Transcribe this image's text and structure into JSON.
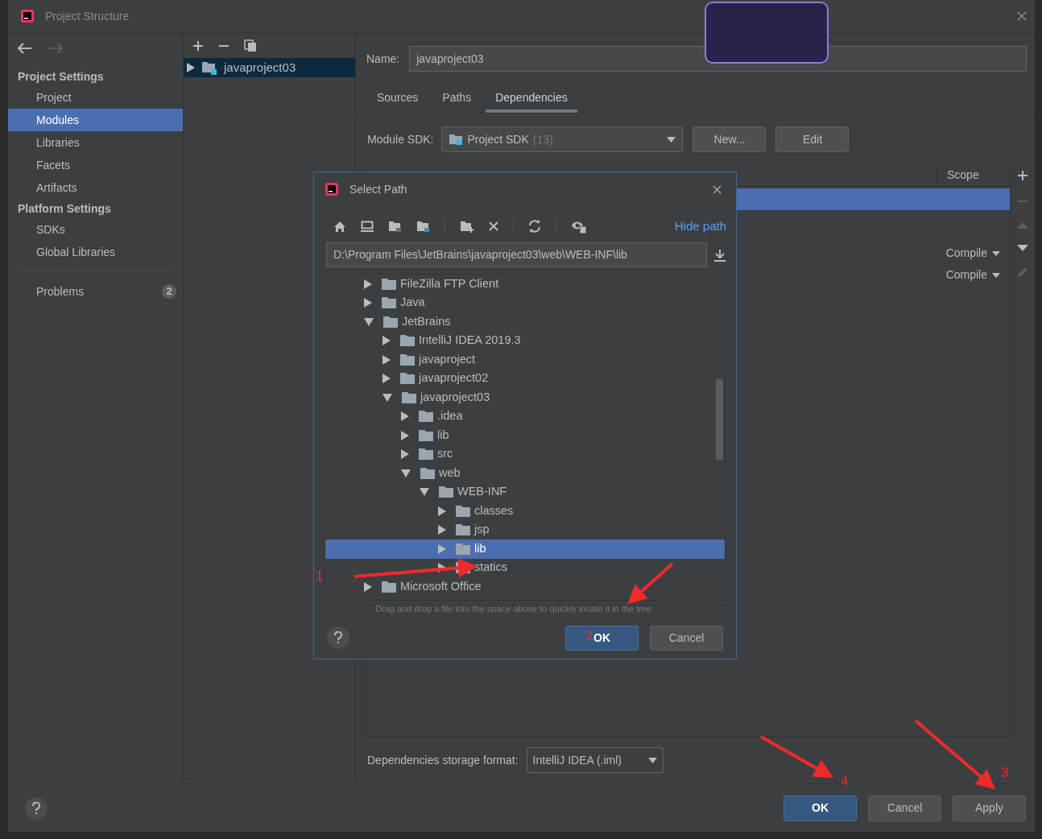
{
  "window": {
    "title": "Project Structure"
  },
  "sidebar": {
    "sections": [
      {
        "heading": "Project Settings",
        "items": [
          {
            "label": "Project",
            "selected": false
          },
          {
            "label": "Modules",
            "selected": true
          },
          {
            "label": "Libraries",
            "selected": false
          },
          {
            "label": "Facets",
            "selected": false
          },
          {
            "label": "Artifacts",
            "selected": false
          }
        ]
      },
      {
        "heading": "Platform Settings",
        "items": [
          {
            "label": "SDKs",
            "selected": false
          },
          {
            "label": "Global Libraries",
            "selected": false
          }
        ]
      }
    ],
    "problems": {
      "label": "Problems",
      "count": "2"
    }
  },
  "modules": [
    {
      "label": "javaproject03",
      "selected": true,
      "expanded": false
    }
  ],
  "module": {
    "name_label": "Name:",
    "name": "javaproject03",
    "tabs": [
      {
        "label": "Sources",
        "selected": false
      },
      {
        "label": "Paths",
        "selected": false
      },
      {
        "label": "Dependencies",
        "selected": true
      }
    ],
    "sdk_label": "Module SDK:",
    "sdk": "Project SDK",
    "sdk_version": "(13)",
    "buttons": [
      "New...",
      "Edit"
    ],
    "table": {
      "columns": [
        "Scope"
      ],
      "rows": [
        {
          "selected": true
        },
        {
          "selected": false,
          "scope": "Compile"
        },
        {
          "selected": false,
          "scope": "Compile"
        }
      ]
    },
    "storage_label": "Dependencies storage format:",
    "storage": "IntelliJ IDEA (.iml)"
  },
  "dialog": {
    "title": "Select Path",
    "hide_path": "Hide path",
    "path": "D:\\Program Files\\JetBrains\\javaproject03\\web\\WEB-INF\\lib",
    "tree": [
      {
        "label": "FileZilla FTP Client",
        "expanded": false,
        "selected": false
      },
      {
        "label": "Java",
        "expanded": false,
        "selected": false
      },
      {
        "label": "JetBrains",
        "expanded": true,
        "selected": false,
        "children": [
          {
            "label": "IntelliJ IDEA 2019.3",
            "expanded": false,
            "selected": false
          },
          {
            "label": "javaproject",
            "expanded": false,
            "selected": false
          },
          {
            "label": "javaproject02",
            "expanded": false,
            "selected": false
          },
          {
            "label": "javaproject03",
            "expanded": true,
            "selected": false,
            "children": [
              {
                "label": ".idea",
                "expanded": false,
                "selected": false
              },
              {
                "label": "lib",
                "expanded": false,
                "selected": false
              },
              {
                "label": "src",
                "expanded": false,
                "selected": false
              },
              {
                "label": "web",
                "expanded": true,
                "selected": false,
                "children": [
                  {
                    "label": "WEB-INF",
                    "expanded": true,
                    "selected": false,
                    "children": [
                      {
                        "label": "classes",
                        "expanded": false,
                        "selected": false
                      },
                      {
                        "label": "jsp",
                        "expanded": false,
                        "selected": false
                      },
                      {
                        "label": "lib",
                        "expanded": false,
                        "selected": true
                      },
                      {
                        "label": "statics",
                        "expanded": false,
                        "selected": false
                      }
                    ]
                  }
                ]
              }
            ]
          }
        ]
      },
      {
        "label": "Microsoft Office",
        "expanded": false,
        "selected": false
      }
    ],
    "hint": "Drag and drop a file into the space above to quickly locate it in the tree",
    "buttons": [
      {
        "label": "OK",
        "primary": true
      },
      {
        "label": "Cancel",
        "primary": false
      }
    ]
  },
  "footer": {
    "buttons": [
      {
        "label": "OK",
        "primary": true
      },
      {
        "label": "Cancel",
        "primary": false
      },
      {
        "label": "Apply",
        "primary": false
      }
    ]
  },
  "annotations": [
    {
      "label": "1"
    },
    {
      "label": "2"
    },
    {
      "label": "3"
    },
    {
      "label": "4"
    }
  ]
}
